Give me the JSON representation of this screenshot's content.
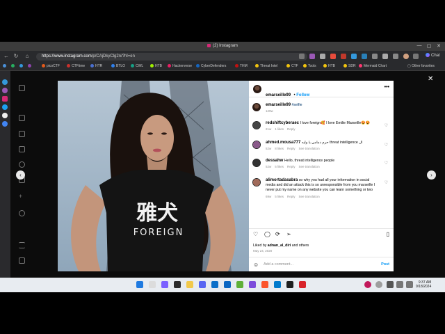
{
  "window": {
    "title": "(2) Instagram"
  },
  "addressbar": {
    "url_host": "https://www.instagram.com",
    "url_path": "/p/CAjDkyClg2n/?hl=en",
    "chat_label": "Chat"
  },
  "bookmarks": {
    "items": [
      {
        "label": "picoCTF",
        "color": "#e25a1c"
      },
      {
        "label": "CTFtime",
        "color": "#c9302c"
      },
      {
        "label": "HTR",
        "color": "#4a6fd1"
      },
      {
        "label": "BTLO",
        "color": "#2f80ed"
      },
      {
        "label": "CWL",
        "color": "#16a085"
      },
      {
        "label": "HTB",
        "color": "#9fef00"
      },
      {
        "label": "Hackerverse",
        "color": "#e91e63"
      },
      {
        "label": "CyberDefenders",
        "color": "#1565c0"
      },
      {
        "label": "THM",
        "color": "#c11111"
      },
      {
        "label": "Threat Intel",
        "color": "#f1c40f"
      },
      {
        "label": "CTF",
        "color": "#f1c40f"
      },
      {
        "label": "Tools",
        "color": "#f1c40f"
      },
      {
        "label": "HTB",
        "color": "#f1c40f"
      },
      {
        "label": "SDR",
        "color": "#f1c40f"
      },
      {
        "label": "Mermaid Chart",
        "color": "#ff3670"
      }
    ],
    "other_label": "Other favorites"
  },
  "post": {
    "author": "emarseille99",
    "follow_label": "Follow",
    "more_icon": "more-horizontal-icon",
    "caption": {
      "user": "emarseille99",
      "hashtag": "#selfie",
      "time": "129w"
    },
    "comments": [
      {
        "user": "redshiftcyberaec",
        "text": "I love foreign🥰 I love Emilie Marseille😍😍",
        "time": "21w",
        "likes": "1 likes",
        "reply": "Reply",
        "translate": ""
      },
      {
        "user": "ahmed.mousa777",
        "text": "حرم دمامي يا وليه threat intelligence ال",
        "time": "52w",
        "likes": "8 likes",
        "reply": "Reply",
        "translate": "See translation"
      },
      {
        "user": "dessahw",
        "text": "Hello, threat intelligence people",
        "time": "52w",
        "likes": "5 likes",
        "reply": "Reply",
        "translate": "See translation"
      },
      {
        "user": "alimortadasabra",
        "text": "so why you had all your information in social media and did an attack this is so unresponsible from you marseille I never put my name on any website you can learn something or two",
        "time": "69w",
        "likes": "5 likes",
        "reply": "Reply",
        "translate": "See translation"
      }
    ],
    "liked_by": {
      "prefix": "Liked by",
      "user": "adnan_al_diri",
      "suffix": "and others"
    },
    "date": "May 24, 2020",
    "add_comment_placeholder": "Add a comment...",
    "post_label": "Post",
    "shirt_text_jp": "雅犬",
    "shirt_text": "FOREIGN"
  },
  "taskbar": {
    "time": "9:37 AM",
    "date": "9/18/2024"
  }
}
